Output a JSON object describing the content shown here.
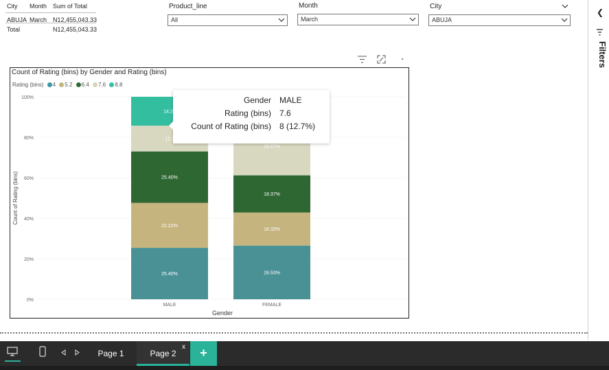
{
  "summary_table": {
    "headers": [
      "City",
      "Month",
      "Sum of Total"
    ],
    "rows": [
      {
        "city": "ABUJA",
        "month": "March",
        "total": "N12,455,043.33"
      }
    ],
    "total_row": {
      "label": "Total",
      "total": "N12,455,043.33"
    }
  },
  "slicers": {
    "product_line": {
      "label": "Product_line",
      "value": "All"
    },
    "month": {
      "label": "Month",
      "value": "March"
    },
    "city": {
      "label": "City",
      "value": "ABUJA"
    }
  },
  "filters_pane": {
    "label": "Filters"
  },
  "chart": {
    "title": "Count of Rating (bins) by Gender and Rating (bins)",
    "legend_title": "Rating (bins)",
    "legend": [
      {
        "name": "4",
        "color": "#3a9aa0"
      },
      {
        "name": "5.2",
        "color": "#c4b47d"
      },
      {
        "name": "6.4",
        "color": "#2f6a37"
      },
      {
        "name": "7.6",
        "color": "#d6d5bc"
      },
      {
        "name": "8.8",
        "color": "#35bfa0"
      }
    ]
  },
  "chart_data": {
    "type": "bar",
    "stacked": "100%",
    "title": "Count of Rating (bins) by Gender and Rating (bins)",
    "xlabel": "Gender",
    "ylabel": "Count of Rating (bins)",
    "categories": [
      "MALE",
      "FEMALE"
    ],
    "yticks": [
      "0%",
      "20%",
      "40%",
      "60%",
      "80%",
      "100%"
    ],
    "ylim": [
      0,
      100
    ],
    "grid": true,
    "legend_position": "top-left",
    "series": [
      {
        "name": "4",
        "color": "#4a9196",
        "values": [
          25.4,
          26.53
        ],
        "labels": [
          "25.40%",
          "26.53%"
        ]
      },
      {
        "name": "5.2",
        "color": "#c5b47e",
        "values": [
          22.22,
          16.33
        ],
        "labels": [
          "22.22%",
          "16.33%"
        ]
      },
      {
        "name": "6.4",
        "color": "#2f6733",
        "values": [
          25.4,
          18.37
        ],
        "labels": [
          "25.40%",
          "18.37%"
        ]
      },
      {
        "name": "7.6",
        "color": "#d8d8c0",
        "values": [
          12.7,
          28.57
        ],
        "labels": [
          "12.7",
          "28.57%"
        ]
      },
      {
        "name": "8.8",
        "color": "#34bea0",
        "values": [
          14.29,
          10.2
        ],
        "labels": [
          "14.29",
          ""
        ]
      }
    ]
  },
  "tooltip": {
    "rows": [
      {
        "key": "Gender",
        "value": "MALE"
      },
      {
        "key": "Rating (bins)",
        "value": "7.6"
      },
      {
        "key": "Count of Rating (bins)",
        "value": "8 (12.7%)"
      }
    ]
  },
  "pages": {
    "tabs": [
      {
        "label": "Page 1",
        "active": false
      },
      {
        "label": "Page 2",
        "active": true
      }
    ],
    "close": "x",
    "add": "+"
  }
}
